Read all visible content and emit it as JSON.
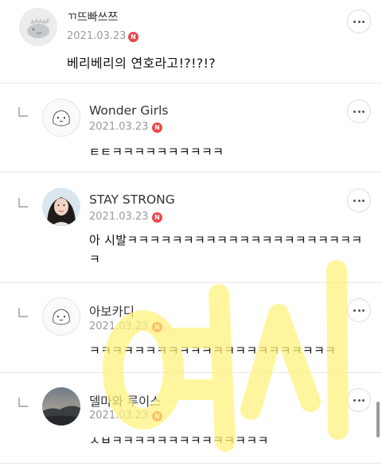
{
  "comments": [
    {
      "name": "ㄲ뜨빠쓰쯔",
      "date": "2021.03.23",
      "badge": "N",
      "text": "베리베리의 연호라고!?!?!?",
      "avatar_icon": "sleeping-character-avatar"
    },
    {
      "name": "Wonder Girls",
      "date": "2021.03.23",
      "badge": "N",
      "text": "ㅌㅌㅋㅋㅋㅋㅋㅋㅋㅋㅋㅋ",
      "avatar_icon": "default-face-avatar"
    },
    {
      "name": "STAY STRONG",
      "date": "2021.03.23",
      "badge": "N",
      "text": "아 시발ㅋㅋㅋㅋㅋㅋㅋㅋㅋㅋㅋㅋㅋㅋㅋㅋㅋㅋㅋㅋㅋㅋ",
      "avatar_icon": "person-photo-avatar"
    },
    {
      "name": "아보카디",
      "date": "2021.03.23",
      "badge": "N",
      "text": "ㅋㅋㅋㅋㅋㅋㅋㅋㅋㅋㅋㅋㅋㅋㅋㅋㅋㅋㅋㅋㅋㅋ",
      "avatar_icon": "default-face-avatar"
    },
    {
      "name": "델마와 루이스",
      "date": "2021.03.23",
      "badge": "N",
      "text": "ㅅㅂㅋㅋㅋㅋㅋㅋㅋㅋㅋㅋㅋㅋㅋㅋ",
      "avatar_icon": "landscape-photo-avatar"
    }
  ],
  "watermark": {
    "text": "여시",
    "color": "#fff27a"
  },
  "colors": {
    "badge": "#e8474c",
    "date": "#9a9a9a",
    "divider": "#e7e7e7"
  }
}
